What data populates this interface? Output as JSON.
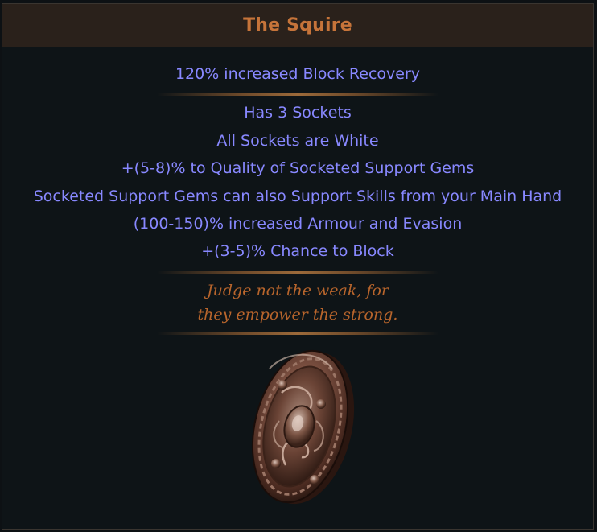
{
  "item": {
    "name": "The Squire",
    "implicit_mods": [
      "120% increased Block Recovery"
    ],
    "explicit_mods": [
      "Has 3 Sockets",
      "All Sockets are White",
      "+(5-8)% to Quality of Socketed Support Gems",
      "Socketed Support Gems can also Support Skills from your Main Hand",
      "(100-150)% increased Armour and Evasion",
      "+(3-5)% Chance to Block"
    ],
    "flavour_text": [
      "Judge not the weak, for",
      "they empower the strong."
    ],
    "image_icon": "round-shield-icon"
  },
  "colors": {
    "title": "#c6743a",
    "header_bg": "#2a211b",
    "body_bg": "#0e1417",
    "magic_mod": "#8888ff",
    "flavour": "#b8652c",
    "separator": "#9c6a3a"
  }
}
